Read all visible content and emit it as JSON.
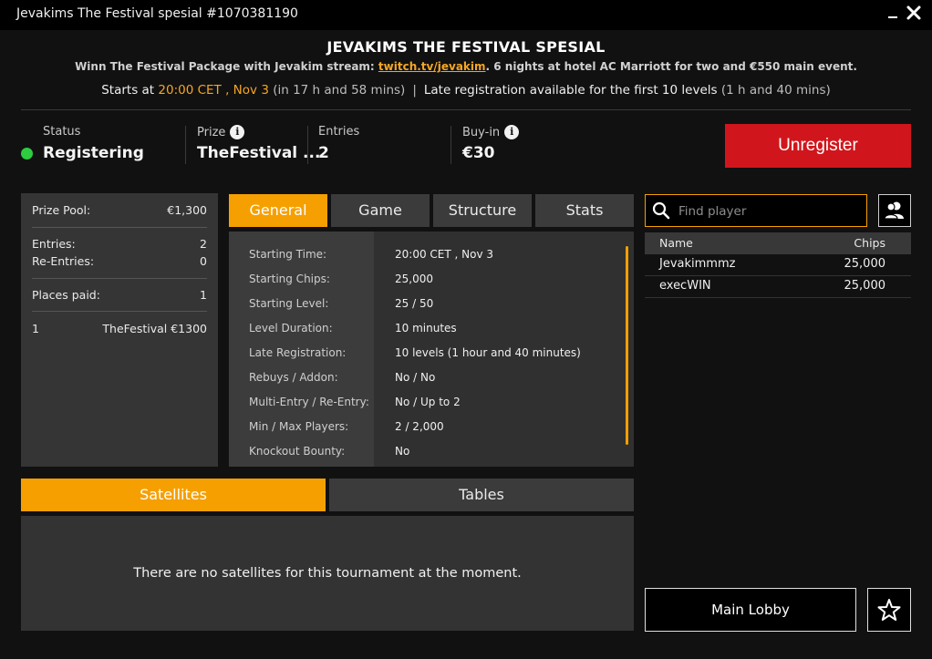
{
  "window": {
    "title": "Jevakims The Festival spesial #1070381190",
    "minimize_icon": "minimize-icon",
    "close_icon": "close-icon"
  },
  "header": {
    "title": "JEVAKIMS THE FESTIVAL SPESIAL",
    "desc_before": "Winn The Festival Package with Jevakim stream: ",
    "desc_link": "twitch.tv/jevakim",
    "desc_after": ". 6 nights at hotel AC Marriott for two and €550 main event.",
    "starts_prefix": "Starts at ",
    "starts_time": "20:00 CET , Nov 3",
    "starts_countdown": "(in 17 h and 58 mins)",
    "separator": "|",
    "late_reg_text": "Late registration available for the first 10 levels",
    "late_reg_time": "(1 h and 40 mins)"
  },
  "status_bar": {
    "status_label": "Status",
    "status_value": "Registering",
    "prize_label": "Prize",
    "prize_value": "TheFestival ...",
    "entries_label": "Entries",
    "entries_value": "2",
    "buyin_label": "Buy-in",
    "buyin_value": "€30",
    "unregister_label": "Unregister",
    "status_color": "#2ecc40",
    "accent_red": "#d0161c"
  },
  "summary": {
    "prize_pool_label": "Prize Pool:",
    "prize_pool_value": "€1,300",
    "entries_label": "Entries:",
    "entries_value": "2",
    "reentries_label": "Re-Entries:",
    "reentries_value": "0",
    "places_paid_label": "Places paid:",
    "places_paid_value": "1",
    "payout_place": "1",
    "payout_prize": "TheFestival €1300"
  },
  "tabs": {
    "general": "General",
    "game": "Game",
    "structure": "Structure",
    "stats": "Stats",
    "active": "General",
    "accent": "#f5a000"
  },
  "general_details": [
    {
      "label": "Starting Time:",
      "value": "20:00 CET , Nov 3"
    },
    {
      "label": "Starting Chips:",
      "value": "25,000"
    },
    {
      "label": "Starting Level:",
      "value": "25 / 50"
    },
    {
      "label": "Level Duration:",
      "value": "10 minutes"
    },
    {
      "label": "Late Registration:",
      "value": "10 levels (1 hour and 40 minutes)"
    },
    {
      "label": "Rebuys / Addon:",
      "value": "No / No"
    },
    {
      "label": "Multi-Entry / Re-Entry:",
      "value": "No / Up to 2"
    },
    {
      "label": "Min / Max Players:",
      "value": "2 / 2,000"
    },
    {
      "label": "Knockout Bounty:",
      "value": "No"
    }
  ],
  "bottom_tabs": {
    "satellites": "Satellites",
    "tables": "Tables",
    "active": "Satellites",
    "empty_message": "There are no satellites for this tournament at the moment."
  },
  "players": {
    "search_placeholder": "Find player",
    "col_name": "Name",
    "col_chips": "Chips",
    "rows": [
      {
        "name": "Jevakimmmz",
        "chips": "25,000"
      },
      {
        "name": "execWIN",
        "chips": "25,000"
      }
    ]
  },
  "footer": {
    "main_lobby_label": "Main Lobby",
    "favorite_icon": "star-icon"
  }
}
